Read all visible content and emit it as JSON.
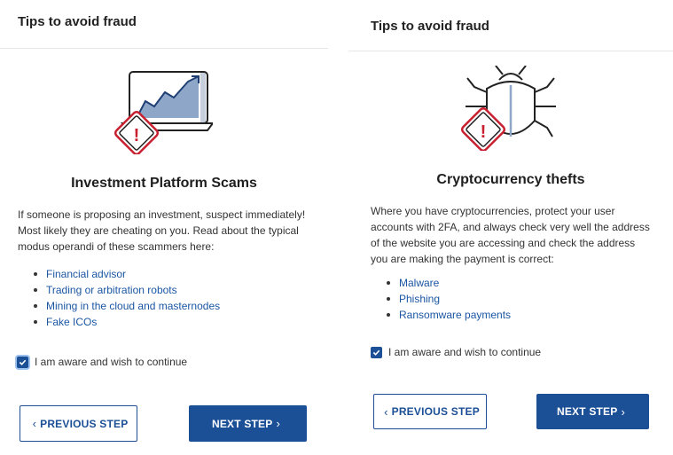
{
  "left": {
    "header": "Tips to avoid fraud",
    "title": "Investment Platform Scams",
    "description": "If someone is proposing an investment, suspect immediately! Most likely they are cheating on you. Read about the typical modus operandi of these scammers here:",
    "links": [
      "Financial advisor",
      "Trading or arbitration robots",
      "Mining in the cloud and masternodes",
      "Fake ICOs"
    ],
    "checkbox_label": "I am aware and wish to continue",
    "prev_label": "PREVIOUS STEP",
    "next_label": "NEXT STEP",
    "illustration": "laptop-chart-warning-icon"
  },
  "right": {
    "header": "Tips to avoid fraud",
    "title": "Cryptocurrency thefts",
    "description": "Where you have cryptocurrencies, protect your user accounts with 2FA, and always check very well the address of the website you are accessing and check the address you are making the payment is correct:",
    "links": [
      "Malware",
      "Phishing",
      "Ransomware payments"
    ],
    "checkbox_label": "I am aware and wish to continue",
    "prev_label": "PREVIOUS STEP",
    "next_label": "NEXT STEP",
    "illustration": "bug-warning-icon"
  },
  "colors": {
    "primary": "#1b4f96",
    "link": "#1b56a3",
    "warning": "#c8202f"
  }
}
